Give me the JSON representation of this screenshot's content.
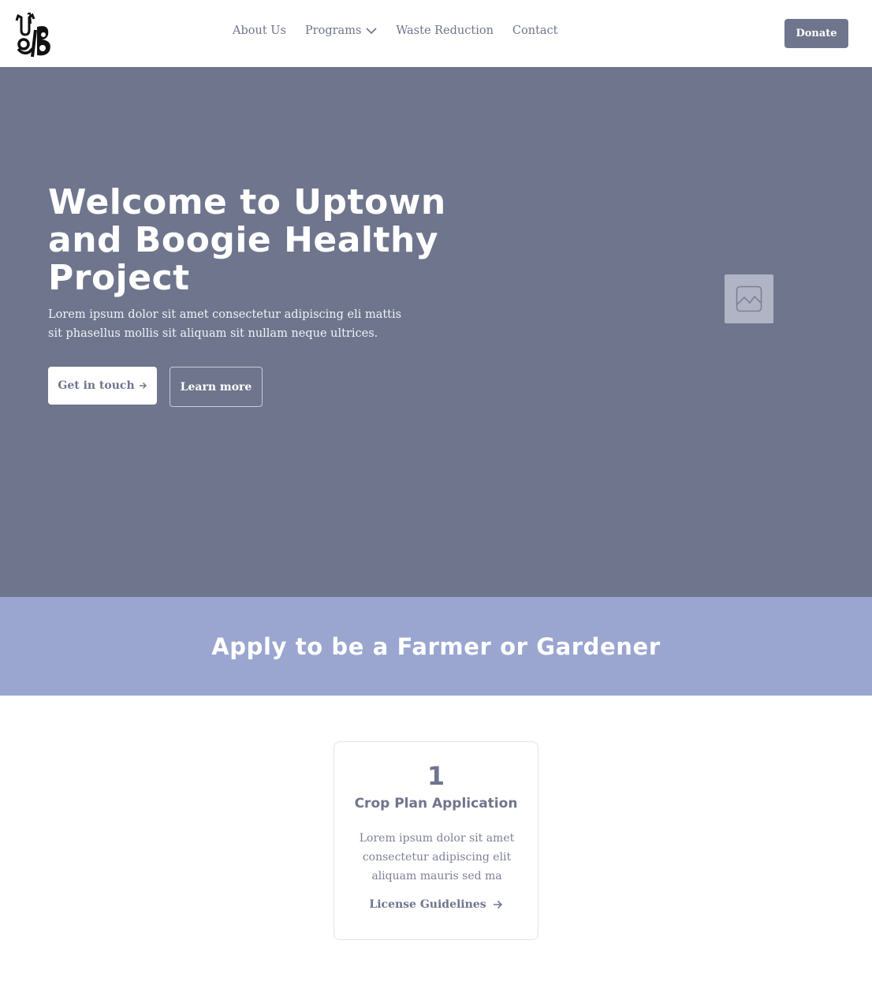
{
  "header": {
    "logo_alt": "U&B",
    "nav": [
      {
        "label": "About Us"
      },
      {
        "label": "Programs"
      },
      {
        "label": "Waste Reduction"
      },
      {
        "label": "Contact"
      }
    ],
    "donate_label": "Donate"
  },
  "hero": {
    "title": "Welcome to Uptown and Boogie Healthy Project",
    "subtitle": "Lorem ipsum dolor sit amet consectetur adipiscing eli mattis sit phasellus mollis sit aliquam sit nullam neque ultrices.",
    "primary_button": "Get in touch",
    "secondary_button": "Learn more",
    "image_icon": "image-placeholder-icon"
  },
  "band": {
    "title": "Apply to be a Farmer or Gardener"
  },
  "card": {
    "number": "1",
    "title": "Crop Plan Application",
    "text": "Lorem ipsum dolor sit amet consectetur adipiscing elit aliquam mauris sed ma",
    "link": "License Guidelines"
  },
  "colors": {
    "primary": "#6f758c",
    "band": "#9aa6d0",
    "white": "#ffffff"
  }
}
